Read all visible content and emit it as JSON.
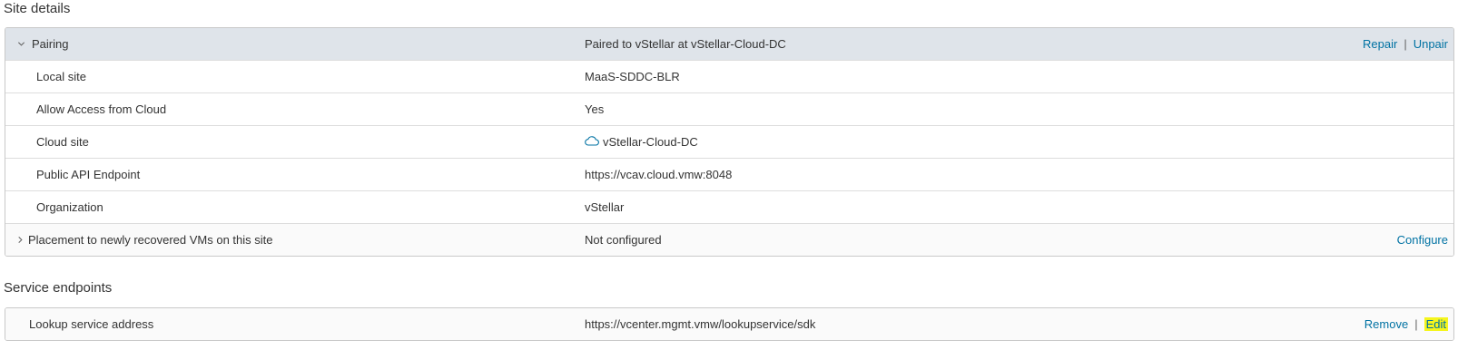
{
  "site_details": {
    "title": "Site details",
    "pairing": {
      "label": "Pairing",
      "value": "Paired to vStellar at vStellar-Cloud-DC",
      "actions": {
        "repair": "Repair",
        "separator": "|",
        "unpair": "Unpair"
      }
    },
    "rows": [
      {
        "label": "Local site",
        "value": "MaaS-SDDC-BLR"
      },
      {
        "label": "Allow Access from Cloud",
        "value": "Yes"
      },
      {
        "label": "Cloud site",
        "value": "vStellar-Cloud-DC",
        "icon": "cloud-icon"
      },
      {
        "label": "Public API Endpoint",
        "value": "https://vcav.cloud.vmw:8048"
      },
      {
        "label": "Organization",
        "value": "vStellar"
      }
    ],
    "placement": {
      "label": "Placement to newly recovered VMs on this site",
      "value": "Not configured",
      "action": "Configure"
    }
  },
  "service_endpoints": {
    "title": "Service endpoints",
    "rows": [
      {
        "label": "Lookup service address",
        "value": "https://vcenter.mgmt.vmw/lookupservice/sdk",
        "actions": {
          "remove": "Remove",
          "separator": "|",
          "edit": "Edit"
        }
      }
    ]
  },
  "colors": {
    "link": "#0072a3",
    "header_bg": "#dfe4ea",
    "highlight": "#f5f51d",
    "border": "#c9c9c9"
  }
}
